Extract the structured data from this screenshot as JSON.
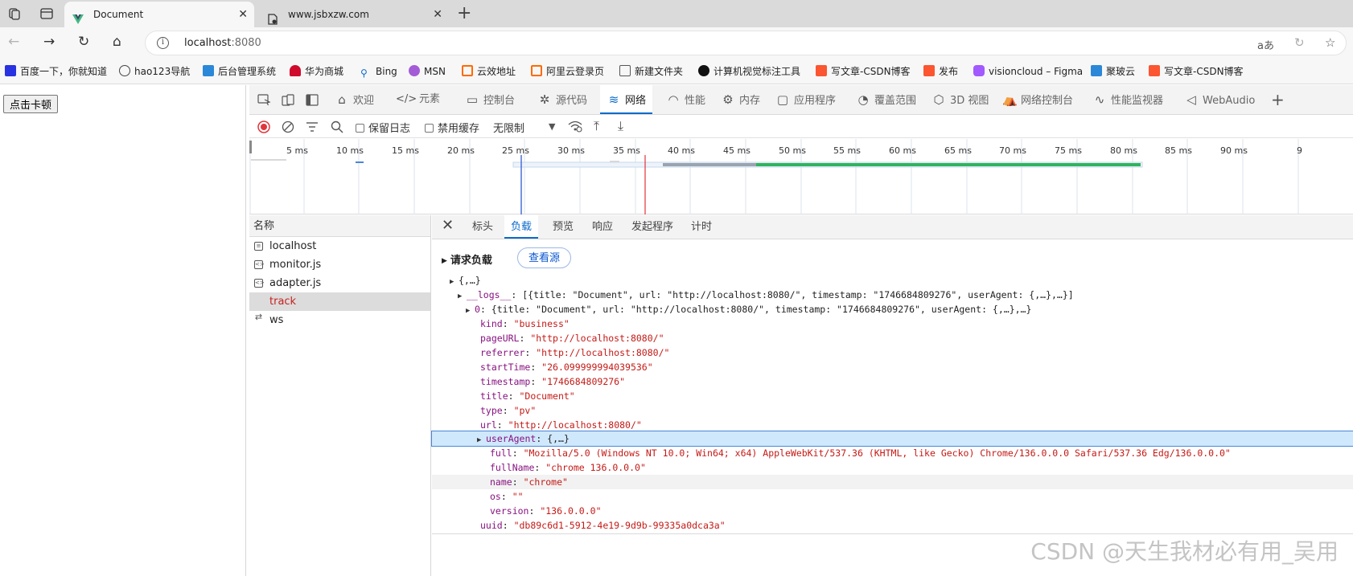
{
  "browser": {
    "tabs": [
      {
        "title": "Document",
        "active": true
      },
      {
        "title": "www.jsbxzw.com",
        "active": false
      }
    ],
    "address": {
      "host": "localhost",
      "port": ":8080"
    },
    "bookmarks": [
      {
        "label": "百度一下，你就知道",
        "icon": "baidu-icon",
        "color": "#2932e1"
      },
      {
        "label": "hao123导航",
        "icon": "globe-icon",
        "color": "#444444"
      },
      {
        "label": "后台管理系统",
        "icon": "page-icon",
        "color": "#2b88d8"
      },
      {
        "label": "华为商城",
        "icon": "huawei-icon",
        "color": "#cf0a2c"
      },
      {
        "label": "Bing",
        "icon": "search-icon",
        "color": "#0b6bcb"
      },
      {
        "label": "MSN",
        "icon": "msn-icon",
        "color": "#a35cd6"
      },
      {
        "label": "云效地址",
        "icon": "aliyun-icon",
        "color": "#ff6a00"
      },
      {
        "label": "阿里云登录页",
        "icon": "aliyun-icon",
        "color": "#ff6a00"
      },
      {
        "label": "新建文件夹",
        "icon": "folder-icon",
        "color": "#555555"
      },
      {
        "label": "计算机视觉标注工具",
        "icon": "tool-icon",
        "color": "#111111"
      },
      {
        "label": "写文章-CSDN博客",
        "icon": "csdn-icon",
        "color": "#fc5531"
      },
      {
        "label": "发布",
        "icon": "csdn-icon",
        "color": "#fc5531"
      },
      {
        "label": "visioncloud – Figma",
        "icon": "figma-icon",
        "color": "#a259ff"
      },
      {
        "label": "聚玻云",
        "icon": "page-icon",
        "color": "#2b88d8"
      },
      {
        "label": "写文章-CSDN博客",
        "icon": "csdn-icon",
        "color": "#fc5531"
      }
    ]
  },
  "page": {
    "button_label": "点击卡顿"
  },
  "devtools": {
    "tabs": [
      {
        "label": "欢迎",
        "icon": "home-icon",
        "glyph": "⌂"
      },
      {
        "label": "元素",
        "icon": "code-icon",
        "glyph": "</>"
      },
      {
        "label": "控制台",
        "icon": "console-icon",
        "glyph": "▭"
      },
      {
        "label": "源代码",
        "icon": "bug-icon",
        "glyph": "✲"
      },
      {
        "label": "网络",
        "icon": "wifi-icon",
        "glyph": "≋"
      },
      {
        "label": "性能",
        "icon": "performance-icon",
        "glyph": "◠"
      },
      {
        "label": "内存",
        "icon": "memory-icon",
        "glyph": "⚙"
      },
      {
        "label": "应用程序",
        "icon": "application-icon",
        "glyph": "▢"
      },
      {
        "label": "覆盖范围",
        "icon": "coverage-icon",
        "glyph": "◔"
      },
      {
        "label": "3D 视图",
        "icon": "cube-icon",
        "glyph": "⬡"
      },
      {
        "label": "网络控制台",
        "icon": "network-console-icon",
        "glyph": "⛺"
      },
      {
        "label": "性能监视器",
        "icon": "pulse-icon",
        "glyph": "∿"
      },
      {
        "label": "WebAudio",
        "icon": "speaker-icon",
        "glyph": "◁"
      }
    ],
    "active_tab": "网络",
    "network_toolbar": {
      "preserve_log": "保留日志",
      "disable_cache": "禁用缓存",
      "throttling": "无限制"
    },
    "timeline_ticks": [
      "5 ms",
      "10 ms",
      "15 ms",
      "20 ms",
      "25 ms",
      "30 ms",
      "35 ms",
      "40 ms",
      "45 ms",
      "50 ms",
      "55 ms",
      "60 ms",
      "65 ms",
      "70 ms",
      "75 ms",
      "80 ms",
      "85 ms",
      "90 ms",
      "9"
    ],
    "request_list": {
      "header": "名称",
      "rows": [
        {
          "name": "localhost",
          "icon": "document-icon"
        },
        {
          "name": "monitor.js",
          "icon": "script-icon"
        },
        {
          "name": "adapter.js",
          "icon": "script-icon"
        },
        {
          "name": "track",
          "icon": "",
          "selected": true
        },
        {
          "name": "ws",
          "icon": "websocket-icon"
        }
      ]
    },
    "detail_tabs": [
      "标头",
      "负载",
      "预览",
      "响应",
      "发起程序",
      "计时"
    ],
    "active_detail_tab": "负载",
    "payload": {
      "section_title": "请求负载",
      "view_source": "查看源",
      "root": "{,…}",
      "logs_key": "__logs__",
      "logs_summary": "[{title: \"Document\", url: \"http://localhost:8080/\", timestamp: \"1746684809276\", userAgent: {,…},…}]",
      "item0_key": "0",
      "item0_summary": "{title: \"Document\", url: \"http://localhost:8080/\", timestamp: \"1746684809276\", userAgent: {,…},…}",
      "fields": [
        {
          "key": "kind",
          "value": "\"business\""
        },
        {
          "key": "pageURL",
          "value": "\"http://localhost:8080/\""
        },
        {
          "key": "referrer",
          "value": "\"http://localhost:8080/\""
        },
        {
          "key": "startTime",
          "value": "\"26.099999994039536\""
        },
        {
          "key": "timestamp",
          "value": "\"1746684809276\""
        },
        {
          "key": "title",
          "value": "\"Document\""
        },
        {
          "key": "type",
          "value": "\"pv\""
        },
        {
          "key": "url",
          "value": "\"http://localhost:8080/\""
        }
      ],
      "user_agent_key": "userAgent",
      "user_agent_summary": "{,…}",
      "user_agent_fields": [
        {
          "key": "full",
          "value": "\"Mozilla/5.0 (Windows NT 10.0; Win64; x64) AppleWebKit/537.36 (KHTML, like Gecko) Chrome/136.0.0.0 Safari/537.36 Edg/136.0.0.0\""
        },
        {
          "key": "fullName",
          "value": "\"chrome 136.0.0.0\""
        },
        {
          "key": "name",
          "value": "\"chrome\""
        },
        {
          "key": "os",
          "value": "\"\""
        },
        {
          "key": "version",
          "value": "\"136.0.0.0\""
        }
      ],
      "uuid_key": "uuid",
      "uuid_value": "\"db89c6d1-5912-4e19-9d9b-99335a0dca3a\""
    }
  },
  "watermark": "CSDN @天生我材必有用_吴用",
  "colors": {
    "accent": "#0b6bcb",
    "selected_request": "#c5221f",
    "waterfall_green": "#2fb55d",
    "marker_red": "#e2343b",
    "marker_blue": "#4a6fd8"
  }
}
